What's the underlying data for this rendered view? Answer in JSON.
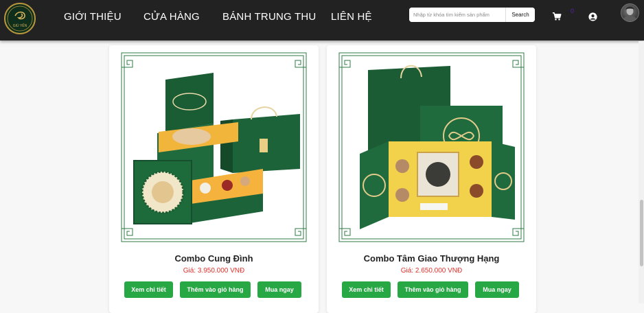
{
  "brand": {
    "logo_text": "GIÙ YẾN",
    "colors": {
      "nav_bg": "#222222",
      "accent_green": "#28a745",
      "price_red": "#e0302a",
      "box_green": "#1f6b3d",
      "gold": "#c9a24a"
    }
  },
  "nav": {
    "links": [
      {
        "label": "GIỚI THIỆU"
      },
      {
        "label": "CỬA HÀNG"
      },
      {
        "label": "BÁNH TRUNG THU"
      },
      {
        "label": "LIÊN HỆ"
      }
    ],
    "search": {
      "placeholder": "Nhập từ khóa tìm kiếm sản phẩm",
      "button_label": "Search"
    },
    "cart": {
      "icon": "cart-icon",
      "count": "0"
    },
    "user": {
      "icon": "user-icon"
    },
    "avatar": {
      "icon": "avatar"
    }
  },
  "products": [
    {
      "name": "Combo Cung Đình",
      "price": "Giá: 3.950.000 VNĐ",
      "buttons": {
        "detail": "Xem chi tiết",
        "add_to_cart": "Thêm vào giỏ hàng",
        "buy_now": "Mua ngay"
      }
    },
    {
      "name": "Combo Tâm Giao Thượng Hạng",
      "price": "Giá: 2.650.000 VNĐ",
      "buttons": {
        "detail": "Xem chi tiết",
        "add_to_cart": "Thêm vào giỏ hàng",
        "buy_now": "Mua ngay"
      }
    }
  ]
}
